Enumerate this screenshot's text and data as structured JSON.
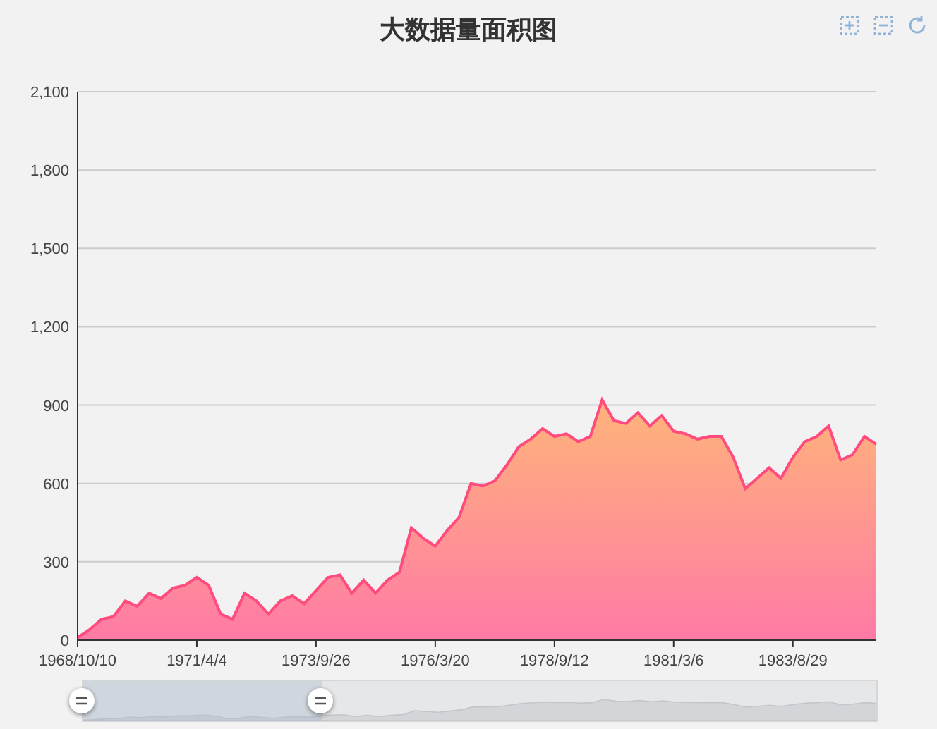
{
  "title": "大数据量面积图",
  "toolbox": [
    {
      "kind": "zoom"
    },
    {
      "kind": "zoom_reset"
    },
    {
      "kind": "restore"
    }
  ],
  "chart": {
    "chart_data": {
      "type": "area",
      "grid": true,
      "ylim": [
        0,
        2100
      ],
      "categories": [
        "1968/10/10",
        null,
        null,
        null,
        null,
        null,
        null,
        null,
        null,
        null,
        "1971/4/4",
        null,
        null,
        null,
        null,
        null,
        null,
        null,
        null,
        null,
        "1973/9/26",
        null,
        null,
        null,
        null,
        null,
        null,
        null,
        null,
        null,
        "1976/3/20",
        null,
        null,
        null,
        null,
        null,
        null,
        null,
        null,
        null,
        "1978/9/12",
        null,
        null,
        null,
        null,
        null,
        null,
        null,
        null,
        null,
        "1981/3/6",
        null,
        null,
        null,
        null,
        null,
        null,
        null,
        null,
        null,
        "1983/8/29",
        null,
        null,
        null,
        null,
        null,
        null,
        null
      ],
      "yticks": [
        {
          "value": 0,
          "label": "0"
        },
        {
          "value": 300,
          "label": "300"
        },
        {
          "value": 600,
          "label": "600"
        },
        {
          "value": 900,
          "label": "900"
        },
        {
          "value": 1200,
          "label": "1,200"
        },
        {
          "value": 1500,
          "label": "1,500"
        },
        {
          "value": 1800,
          "label": "1,800"
        },
        {
          "value": 2100,
          "label": "2,100"
        }
      ],
      "values": [
        10,
        40,
        80,
        90,
        150,
        130,
        180,
        160,
        200,
        210,
        240,
        210,
        100,
        80,
        180,
        150,
        100,
        150,
        170,
        140,
        190,
        240,
        250,
        180,
        230,
        180,
        230,
        260,
        430,
        390,
        360,
        420,
        470,
        600,
        590,
        610,
        670,
        740,
        770,
        810,
        780,
        790,
        760,
        780,
        920,
        840,
        830,
        870,
        820,
        860,
        800,
        790,
        770,
        780,
        780,
        700,
        580,
        620,
        660,
        620,
        700,
        760,
        780,
        820,
        690,
        710,
        780,
        750
      ]
    }
  },
  "zoom_slider": {
    "range_start": {
      "level": 0
    },
    "range_end": {
      "level": 0.3
    }
  }
}
